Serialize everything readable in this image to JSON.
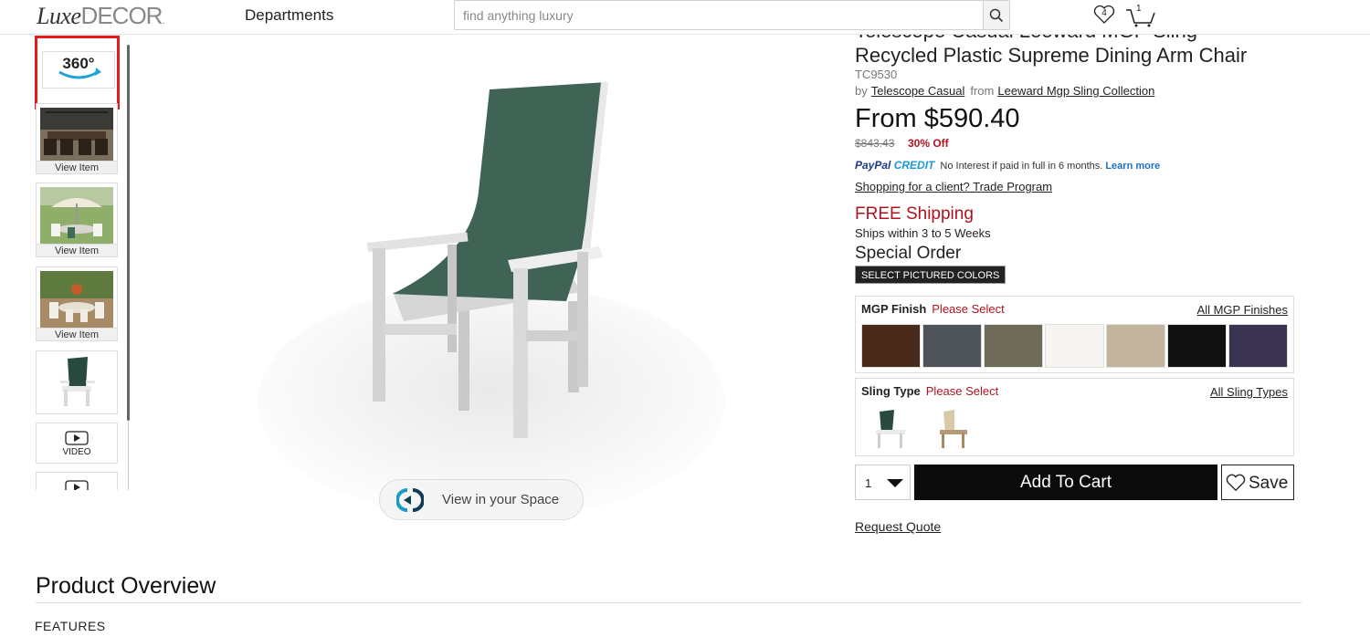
{
  "header": {
    "logo_part1": "Luxe",
    "logo_part2": "DECOR",
    "logo_dot": ".",
    "departments": "Departments",
    "search_placeholder": "find anything luxury",
    "wishlist_count": "4",
    "cart_count": "1"
  },
  "thumbnails": [
    {
      "kind": "360",
      "label": "360°"
    },
    {
      "kind": "image",
      "caption": "View Item"
    },
    {
      "kind": "image",
      "caption": "View Item"
    },
    {
      "kind": "image",
      "caption": "View Item"
    },
    {
      "kind": "image",
      "caption": ""
    },
    {
      "kind": "video",
      "caption": "VIDEO"
    },
    {
      "kind": "video",
      "caption": ""
    }
  ],
  "main": {
    "view_in_space": "View in your Space"
  },
  "product": {
    "title_line1": "Telescope Casual Leeward MGP Sling",
    "title_line2": "Recycled Plastic Supreme Dining Arm Chair",
    "sku": "TC9530",
    "by": "by",
    "brand": "Telescope Casual",
    "from": "from",
    "collection": "Leeward Mgp Sling Collection",
    "price": "From $590.40",
    "was_price": "$843.43",
    "discount": "30% Off",
    "paypal_logo_a": "PayPal",
    "paypal_logo_b": "CREDIT",
    "paypal_text": "No Interest if paid in full in 6 months.",
    "paypal_learn": "Learn more",
    "client_link": "Shopping for a client? Trade Program",
    "free_shipping": "FREE Shipping",
    "ships_within": "Ships within 3 to 5 Weeks",
    "special_order": "Special Order",
    "select_colors": "SELECT PICTURED COLORS"
  },
  "options": {
    "finish": {
      "label": "MGP Finish",
      "prompt": "Please Select",
      "all_link": "All MGP Finishes",
      "swatches": [
        "#4a2a1a",
        "#4e545a",
        "#6e6a58",
        "#f5f4f0",
        "#c3b49e",
        "#111111",
        "#3a3351"
      ]
    },
    "sling": {
      "label": "Sling Type",
      "prompt": "Please Select",
      "all_link": "All Sling Types",
      "items": [
        "green-sling",
        "tan-sling"
      ]
    }
  },
  "cart": {
    "qty": "1",
    "add_to_cart": "Add To Cart",
    "save": "Save",
    "request_quote": "Request Quote"
  },
  "overview": {
    "heading": "Product Overview",
    "features": "FEATURES"
  }
}
